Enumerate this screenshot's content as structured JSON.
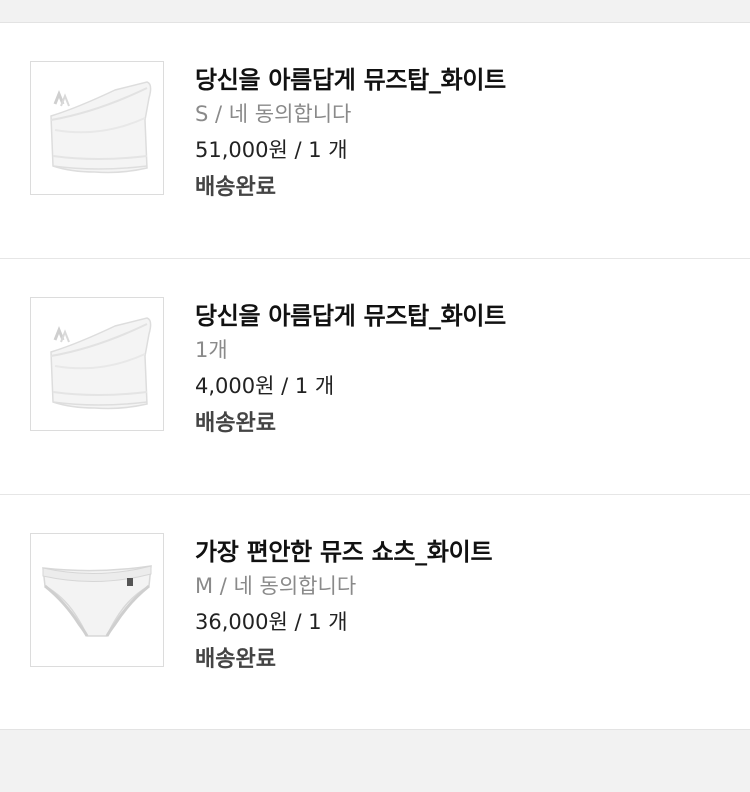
{
  "orders": [
    {
      "name": "당신을 아름답게 뮤즈탑_화이트",
      "option": "S / 네 동의합니다",
      "price": "51,000원 / 1 개",
      "status": "배송완료",
      "image_icon": "one-shoulder-top-icon"
    },
    {
      "name": "당신을 아름답게 뮤즈탑_화이트",
      "option": "1개",
      "price": "4,000원 / 1 개",
      "status": "배송완료",
      "image_icon": "one-shoulder-top-icon"
    },
    {
      "name": "가장 편안한 뮤즈 쇼츠_화이트",
      "option": "M / 네 동의합니다",
      "price": "36,000원 / 1 개",
      "status": "배송완료",
      "image_icon": "briefs-icon"
    }
  ],
  "colors": {
    "background": "#f2f2f2",
    "card": "#ffffff",
    "title": "#111111",
    "option": "#8a8a8a",
    "status": "#444444"
  }
}
